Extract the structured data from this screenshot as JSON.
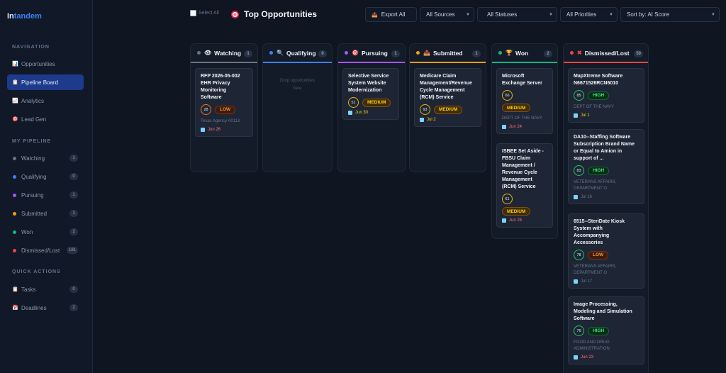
{
  "app": {
    "logo_prefix": "In",
    "logo_suffix": "tandem"
  },
  "sidebar": {
    "nav_heading": "NAVIGATION",
    "nav": [
      {
        "label": "Opportunities",
        "icon": "chart-icon"
      },
      {
        "label": "Pipeline Board",
        "icon": "clipboard-icon",
        "active": true
      },
      {
        "label": "Analytics",
        "icon": "trend-icon"
      },
      {
        "label": "Lead Gen",
        "icon": "target-icon"
      }
    ],
    "pipeline_heading": "MY PIPELINE",
    "pipeline": [
      {
        "label": "Watching",
        "count": "1",
        "color": "#6b7280"
      },
      {
        "label": "Qualifying",
        "count": "0",
        "color": "#3b82f6"
      },
      {
        "label": "Pursuing",
        "count": "1",
        "color": "#a855f7"
      },
      {
        "label": "Submitted",
        "count": "1",
        "color": "#f59e0b"
      },
      {
        "label": "Won",
        "count": "2",
        "color": "#10b981"
      },
      {
        "label": "Dismissed/Lost",
        "count": "181",
        "color": "#ef4444"
      }
    ],
    "quick_heading": "QUICK ACTIONS",
    "quick": [
      {
        "label": "Tasks",
        "count": "0",
        "icon": "clipboard-icon"
      },
      {
        "label": "Deadlines",
        "count": "2",
        "icon": "calendar-icon"
      }
    ]
  },
  "toolbar": {
    "select_all": "Select All",
    "title": "Top Opportunities",
    "export": "Export All",
    "sources": "All Sources",
    "statuses": "All Statuses",
    "priorities": "All Priorities",
    "sort": "Sort by: AI Score"
  },
  "columns": [
    {
      "name": "Watching",
      "count": "1",
      "color": "#6b7280",
      "icon": "eye-icon",
      "glyph": "👁"
    },
    {
      "name": "Qualifying",
      "count": "0",
      "color": "#3b82f6",
      "icon": "magnifier-icon",
      "glyph": "🔍",
      "empty": "Drop opportunities here"
    },
    {
      "name": "Pursuing",
      "count": "1",
      "color": "#a855f7",
      "icon": "target-icon",
      "glyph": "◎"
    },
    {
      "name": "Submitted",
      "count": "1",
      "color": "#f59e0b",
      "icon": "inbox-icon",
      "glyph": "📤"
    },
    {
      "name": "Won",
      "count": "2",
      "color": "#10b981",
      "icon": "trophy-icon",
      "glyph": "🏆"
    },
    {
      "name": "Dismissed/Lost",
      "count": "50",
      "color": "#ef4444",
      "icon": "cross-icon",
      "glyph": "✖"
    }
  ],
  "cards": {
    "watching": [
      {
        "title": "RFP 2026-05-002 EHR Privacy Monitoring Software",
        "score": "28",
        "score_color": "#f97316",
        "priority": "LOW",
        "agency": "Texas Agency A0113",
        "due": "Jun 26",
        "due_color": "#f87171"
      }
    ],
    "pursuing": [
      {
        "title": "Selective Service System Website Modernization",
        "score": "51",
        "score_color": "#eab308",
        "priority": "MEDIUM",
        "due": "Jun 30",
        "due_color": "#facc15"
      }
    ],
    "submitted": [
      {
        "title": "Medicare Claim Management/Revenue Cycle Management (RCM) Service",
        "score": "93",
        "score_color": "#eab308",
        "priority": "MEDIUM",
        "due": "Jul 2",
        "due_color": "#facc15"
      }
    ],
    "won": [
      {
        "title": "Microsoft Exchange Server",
        "score": "66",
        "score_color": "#eab308",
        "priority": "MEDIUM",
        "agency": "DEPT OF THE NAVY",
        "due": "Jun 24",
        "due_color": "#f87171"
      },
      {
        "title": "ISBEE Set Aside - FBSU Claim Management / Revenue Cycle Management (RCM) Service",
        "score": "61",
        "score_color": "#eab308",
        "priority": "MEDIUM",
        "due": "Jun 26",
        "due_color": "#f87171"
      }
    ],
    "dismissed": [
      {
        "title": "MapXtreme Software N6671526RCN6010",
        "score": "85",
        "score_color": "#22c55e",
        "priority": "HIGH",
        "agency": "DEPT OF THE NAVY",
        "due": "Jul 1",
        "due_color": "#facc15"
      },
      {
        "title": "DA10--Staffing Software Subscription Brand Name or Equal to Amion in support of ...",
        "score": "83",
        "score_color": "#22c55e",
        "priority": "HIGH",
        "agency": "VETERANS AFFAIRS, DEPARTMENT O",
        "due": "Jul 16",
        "due_color": "#64748b"
      },
      {
        "title": "6515--SteriDate Kiosk System with Accompanying Accessories",
        "score": "78",
        "score_color": "#22c55e",
        "priority": "LOW",
        "agency": "VETERANS AFFAIRS, DEPARTMENT O",
        "due": "Jul 17",
        "due_color": "#64748b"
      },
      {
        "title": "Image Processing, Modeling and Simulation Software",
        "score": "76",
        "score_color": "#22c55e",
        "priority": "HIGH",
        "agency": "FOOD AND DRUG ADMINISTRATION",
        "due": "Jun 23",
        "due_color": "#f87171"
      }
    ]
  }
}
